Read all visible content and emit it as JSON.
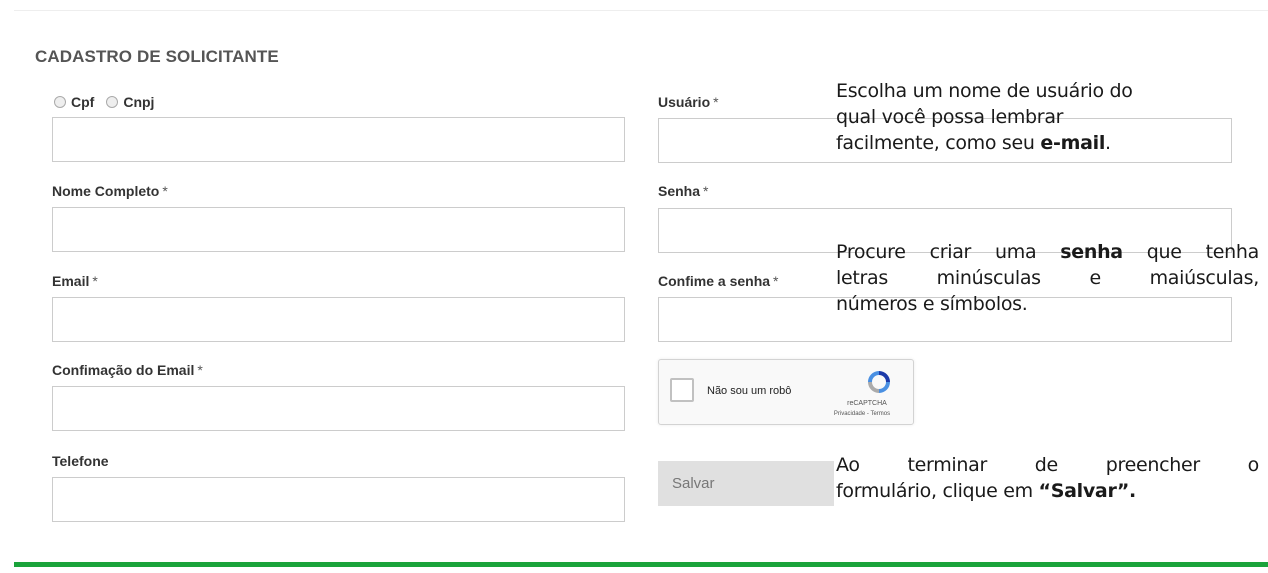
{
  "form": {
    "title": "CADASTRO DE SOLICITANTE",
    "doc_type": {
      "options": [
        "Cpf",
        "Cnpj"
      ]
    },
    "required_mark": "*",
    "fields": {
      "nome": "Nome Completo",
      "email": "Email",
      "confirm_email": "Confimação do Email",
      "telefone": "Telefone",
      "usuario": "Usuário",
      "senha": "Senha",
      "confirm_senha": "Confime a senha"
    },
    "recaptcha": {
      "label": "Não sou um robô",
      "brand": "reCAPTCHA",
      "links": "Privacidade - Termos"
    },
    "save_label": "Salvar"
  },
  "tips": {
    "usuario": {
      "line1": "Escolha um nome de usuário do",
      "line2": "qual você possa lembrar",
      "line3_pre": "facilmente, como seu ",
      "line3_bold": "e-mail",
      "line3_post": "."
    },
    "senha": {
      "line1_pre": "Procure criar uma ",
      "line1_bold": "senha",
      "line1_post": " que tenha",
      "line2": "letras minúsculas e maiúsculas,",
      "line3": "números e símbolos."
    },
    "salvar": {
      "line1": "Ao terminar de preencher o",
      "line2_pre": "formulário, clique em ",
      "line2_bold": "“Salvar”."
    }
  },
  "colors": {
    "accent_bar": "#1aa33b",
    "input_border": "#cccccc"
  },
  "icons": {
    "recaptcha": "recaptcha-logo-icon"
  }
}
